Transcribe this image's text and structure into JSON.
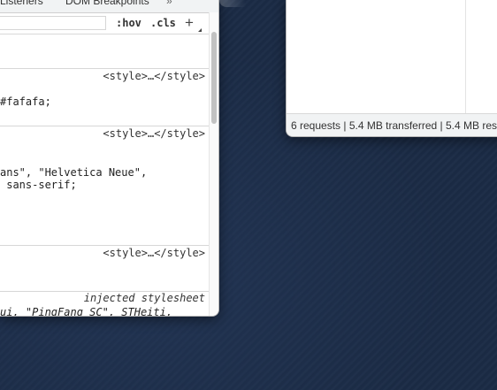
{
  "devtools": {
    "tabs": [
      "Listeners",
      "DOM Breakpoints",
      "»"
    ],
    "toolbar": {
      "hov": ":hov",
      "cls": ".cls",
      "add": "+"
    },
    "rules": [
      {
        "source": "<style>…</style>",
        "lines": [
          "#fafafa;"
        ]
      },
      {
        "source": "<style>…</style>",
        "lines": [
          "ans\", \"Helvetica Neue\",",
          " sans-serif;"
        ]
      },
      {
        "source": "<style>…</style>",
        "lines": []
      },
      {
        "source": "injected stylesheet",
        "lines": [
          "ui, \"PingFang SC\", STHeiti,"
        ]
      }
    ]
  },
  "network": {
    "status": "6 requests | 5.4 MB transferred | 5.4 MB res"
  }
}
